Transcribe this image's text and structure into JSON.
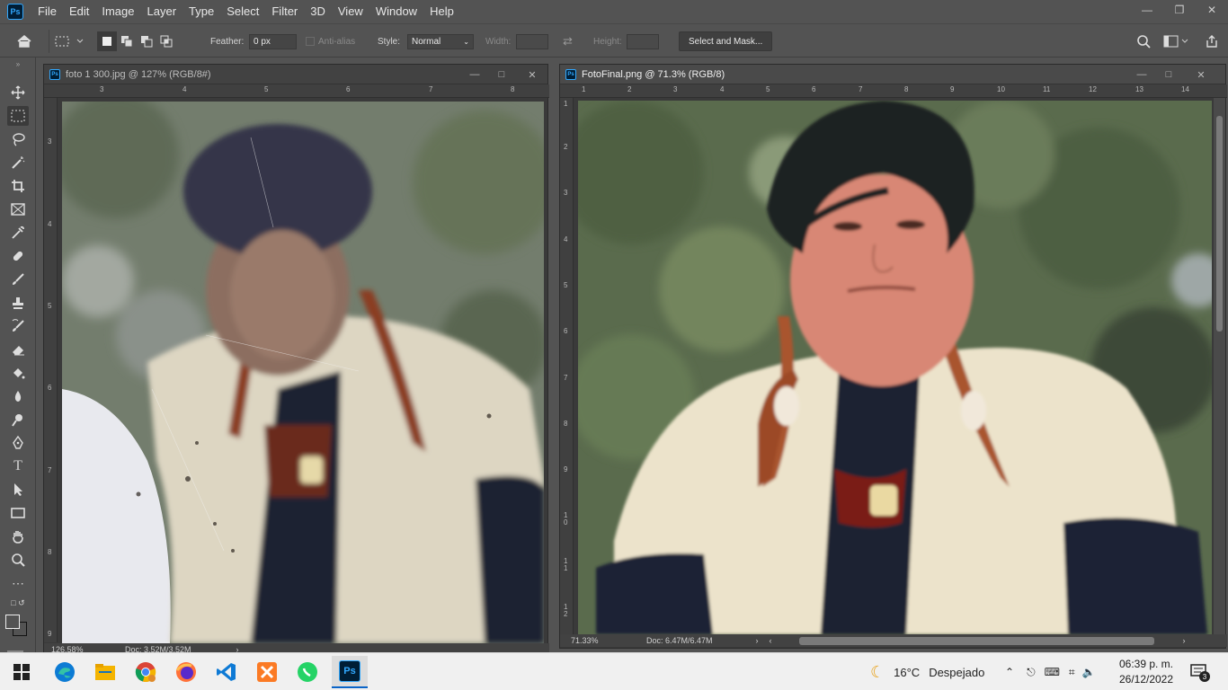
{
  "app": {
    "logo": "Ps",
    "accent": "#31a8ff"
  },
  "menubar": {
    "items": [
      "File",
      "Edit",
      "Image",
      "Layer",
      "Type",
      "Select",
      "Filter",
      "3D",
      "View",
      "Window",
      "Help"
    ]
  },
  "options": {
    "feather_label": "Feather:",
    "feather_value": "0 px",
    "antialias_label": "Anti-alias",
    "style_label": "Style:",
    "style_value": "Normal",
    "width_label": "Width:",
    "height_label": "Height:",
    "select_mask_label": "Select and Mask..."
  },
  "doc1": {
    "title": "foto 1 300.jpg @ 127% (RGB/8#)",
    "ruler_h": [
      "3",
      "4",
      "5",
      "6",
      "7",
      "8"
    ],
    "ruler_v": [
      "3",
      "4",
      "5",
      "6",
      "7",
      "8",
      "9"
    ],
    "zoom": "126.58%",
    "doc_info": "Doc: 3.52M/3.52M"
  },
  "doc2": {
    "title": "FotoFinal.png @ 71.3% (RGB/8)",
    "ruler_h": [
      "1",
      "2",
      "3",
      "4",
      "5",
      "6",
      "7",
      "8",
      "9",
      "10",
      "11",
      "12",
      "13",
      "14"
    ],
    "ruler_v": [
      "1",
      "2",
      "3",
      "4",
      "5",
      "6",
      "7",
      "8",
      "9",
      "10",
      "11",
      "12"
    ],
    "zoom": "71.33%",
    "doc_info": "Doc: 6.47M/6.47M"
  },
  "taskbar": {
    "weather_temp": "16°C",
    "weather_desc": "Despejado",
    "time": "06:39 p. m.",
    "date": "26/12/2022",
    "notif_count": "3",
    "icons": [
      "windows-start-icon",
      "edge-icon",
      "file-explorer-icon",
      "chrome-icon",
      "firefox-icon",
      "vscode-icon",
      "xampp-icon",
      "whatsapp-icon",
      "photoshop-icon"
    ]
  }
}
